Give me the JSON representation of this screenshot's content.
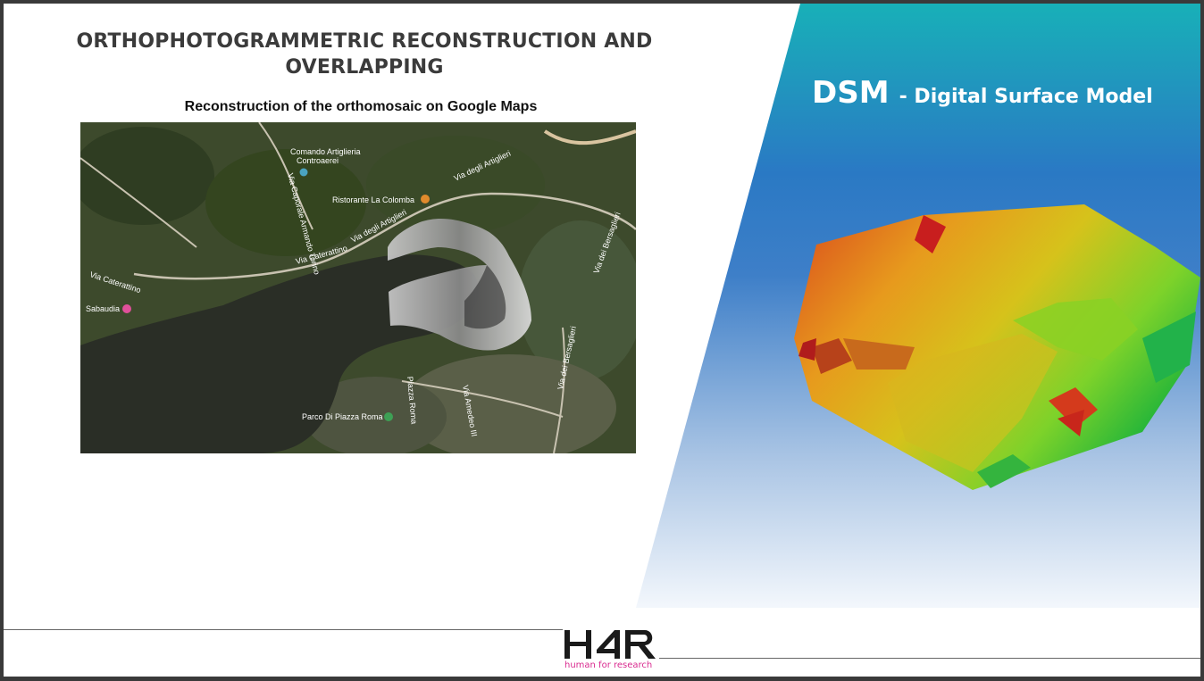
{
  "slide": {
    "title_line1": "ORTHOPHOTOGRAMMETRIC RECONSTRUCTION AND",
    "title_line2": "OVERLAPPING",
    "subtitle": "Reconstruction of the orthomosaic on Google Maps"
  },
  "map": {
    "labels": {
      "comando": "Comando Artiglieria",
      "controaerei": "Controaerei",
      "ristorante": "Ristorante La Colomba",
      "via_artiglieri": "Via degli Artiglieri",
      "via_caterattino_top": "Via Caterattino",
      "via_caterattino_left": "Via Caterattino",
      "sabaudia": "Sabaudia",
      "via_bersaglieri": "Via dei Bersaglieri",
      "via_bersaglieri_2": "Via dei Bersaglieri",
      "via_caporale": "Via Caporale Armando Torino",
      "piazza_roma": "Piazza Roma",
      "via_amedeo": "Via Amedeo III",
      "parco": "Parco Di Piazza Roma"
    },
    "icons": [
      "pin-icon",
      "restaurant-pin-icon",
      "park-pin-icon",
      "city-pin-icon"
    ]
  },
  "dsm": {
    "abbr": "DSM",
    "rest": "- Digital Surface Model"
  },
  "colors": {
    "title": "#3b3b3b",
    "panel_top": "#17a8b8",
    "panel_mid": "#2f6fc0",
    "panel_bottom": "#ffffff",
    "logo_text": "#1a1a1a",
    "logo_tagline": "#d92a8f"
  },
  "logo": {
    "tagline": "human for research"
  }
}
